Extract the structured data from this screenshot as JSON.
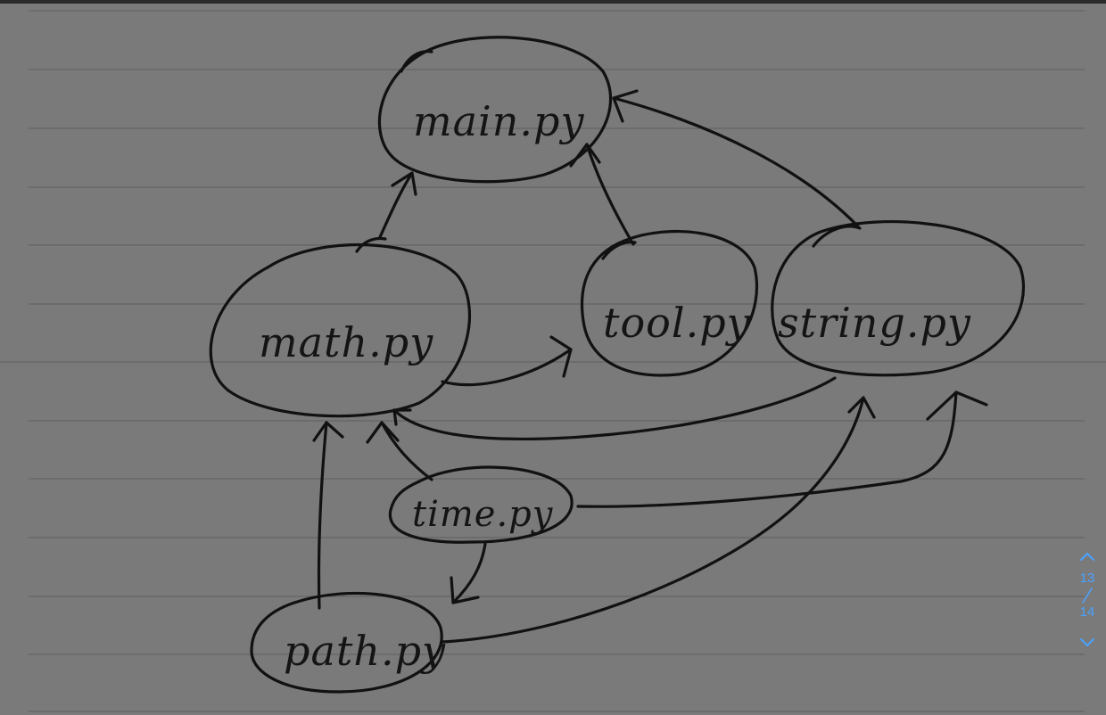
{
  "diagram": {
    "nodes": [
      {
        "id": "main",
        "label": "main.py"
      },
      {
        "id": "math",
        "label": "math.py"
      },
      {
        "id": "tool",
        "label": "tool.py"
      },
      {
        "id": "string",
        "label": "string.py"
      },
      {
        "id": "time",
        "label": "time.py"
      },
      {
        "id": "path",
        "label": "path.py"
      }
    ],
    "edges": [
      {
        "from": "math",
        "to": "main"
      },
      {
        "from": "tool",
        "to": "main"
      },
      {
        "from": "string",
        "to": "main"
      },
      {
        "from": "math",
        "to": "tool"
      },
      {
        "from": "string",
        "to": "math"
      },
      {
        "from": "time",
        "to": "math"
      },
      {
        "from": "path",
        "to": "math"
      },
      {
        "from": "time",
        "to": "path"
      },
      {
        "from": "time",
        "to": "string"
      },
      {
        "from": "path",
        "to": "string"
      }
    ]
  },
  "pager": {
    "current": "13",
    "total": "14",
    "up_icon": "chevron-up-icon",
    "down_icon": "chevron-down-icon",
    "accent": "#4aa3ff"
  },
  "colors": {
    "paper": "#7a7a7a",
    "ink": "#111111",
    "rule": "#5e5e5e"
  }
}
